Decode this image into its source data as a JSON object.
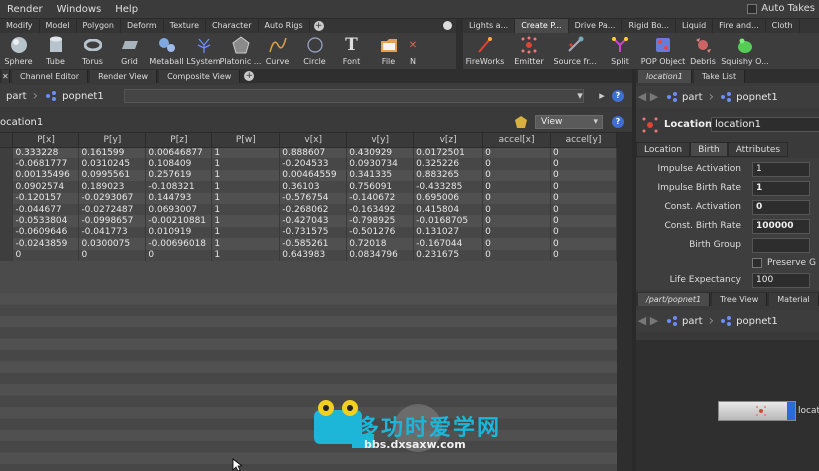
{
  "menubar": {
    "items": [
      "Render",
      "Windows",
      "Help"
    ],
    "auto_takes": "Auto Takes"
  },
  "shelf_left": {
    "tabs": [
      "Modify",
      "Model",
      "Polygon",
      "Deform",
      "Texture",
      "Character",
      "Auto Rigs"
    ],
    "tools": [
      {
        "label": "Sphere",
        "icon": "sphere-icon"
      },
      {
        "label": "Tube",
        "icon": "tube-icon"
      },
      {
        "label": "Torus",
        "icon": "torus-icon"
      },
      {
        "label": "Grid",
        "icon": "grid-icon"
      },
      {
        "label": "Metaball",
        "icon": "metaball-icon"
      },
      {
        "label": "LSystem",
        "icon": "lsystem-icon"
      },
      {
        "label": "Platonic ...",
        "icon": "platonic-icon"
      },
      {
        "label": "Curve",
        "icon": "curve-icon"
      },
      {
        "label": "Circle",
        "icon": "circle-icon"
      },
      {
        "label": "Font",
        "icon": "font-icon"
      },
      {
        "label": "File",
        "icon": "file-icon"
      },
      {
        "label": "N",
        "icon": "null-icon"
      }
    ]
  },
  "shelf_right": {
    "tabs": [
      "Lights a...",
      "Create P...",
      "Drive Pa...",
      "Rigid Bo...",
      "Liquid",
      "Fire and...",
      "Cloth"
    ],
    "tools": [
      {
        "label": "FireWorks",
        "icon": "fireworks-icon"
      },
      {
        "label": "Emitter",
        "icon": "emitter-icon"
      },
      {
        "label": "Source fr...",
        "icon": "source-icon"
      },
      {
        "label": "Split",
        "icon": "split-icon"
      },
      {
        "label": "POP Object",
        "icon": "pop-object-icon"
      },
      {
        "label": "Debris",
        "icon": "debris-icon"
      },
      {
        "label": "Squishy O...",
        "icon": "squishy-icon"
      }
    ]
  },
  "left_pane": {
    "tabs": [
      "Channel Editor",
      "Render View",
      "Composite View"
    ],
    "path": [
      "part",
      "popnet1"
    ],
    "node_name": "ocation1",
    "view_label": "View",
    "columns": [
      "",
      "P[x]",
      "P[y]",
      "P[z]",
      "P[w]",
      "v[x]",
      "v[y]",
      "v[z]",
      "accel[x]",
      "accel[y]"
    ],
    "rows": [
      [
        "",
        "0.333228",
        "0.161599",
        "0.00646877",
        "1",
        "0.888607",
        "0.430929",
        "0.0172501",
        "0",
        "0"
      ],
      [
        "",
        "-0.0681777",
        "0.0310245",
        "0.108409",
        "1",
        "-0.204533",
        "0.0930734",
        "0.325226",
        "0",
        "0"
      ],
      [
        "",
        "0.00135496",
        "0.0995561",
        "0.257619",
        "1",
        "0.00464559",
        "0.341335",
        "0.883265",
        "0",
        "0"
      ],
      [
        "",
        "0.0902574",
        "0.189023",
        "-0.108321",
        "1",
        "0.36103",
        "0.756091",
        "-0.433285",
        "0",
        "0"
      ],
      [
        "",
        "-0.120157",
        "-0.0293067",
        "0.144793",
        "1",
        "-0.576754",
        "-0.140672",
        "0.695006",
        "0",
        "0"
      ],
      [
        "",
        "-0.044677",
        "-0.0272487",
        "0.0693007",
        "1",
        "-0.268062",
        "-0.163492",
        "0.415804",
        "0",
        "0"
      ],
      [
        "",
        "-0.0533804",
        "-0.0998657",
        "-0.00210881",
        "1",
        "-0.427043",
        "-0.798925",
        "-0.0168705",
        "0",
        "0"
      ],
      [
        "",
        "-0.0609646",
        "-0.041773",
        "0.010919",
        "1",
        "-0.731575",
        "-0.501276",
        "0.131027",
        "0",
        "0"
      ],
      [
        "",
        "-0.0243859",
        "0.0300075",
        "-0.00696018",
        "1",
        "-0.585261",
        "0.72018",
        "-0.167044",
        "0",
        "0"
      ],
      [
        "",
        "0",
        "0",
        "0",
        "1",
        "0.643983",
        "0.0834796",
        "0.231675",
        "0",
        "0"
      ]
    ]
  },
  "right_pane": {
    "tabs": [
      "location1",
      "Take List"
    ],
    "path": [
      "part",
      "popnet1"
    ],
    "node_type": "Location",
    "node_name": "location1",
    "param_tabs": [
      "Location",
      "Birth",
      "Attributes"
    ],
    "params": [
      {
        "label": "Impulse Activation",
        "value": "1",
        "bold": false
      },
      {
        "label": "Impulse Birth Rate",
        "value": "1",
        "bold": true
      },
      {
        "label": "Const. Activation",
        "value": "0",
        "bold": true
      },
      {
        "label": "Const. Birth Rate",
        "value": "100000",
        "bold": true
      },
      {
        "label": "Birth Group",
        "value": "",
        "bold": false
      },
      {
        "label": "",
        "value": "Preserve G",
        "bold": false
      },
      {
        "label": "Life Expectancy",
        "value": "100",
        "bold": false
      }
    ],
    "net_tabs": [
      "/part/popnet1",
      "Tree View",
      "Material"
    ],
    "net_path": [
      "part",
      "popnet1"
    ],
    "net_node_label": "locat"
  },
  "watermark": {
    "main": "多功时爱学网",
    "sub": "bbs.dxsaxw.com"
  }
}
